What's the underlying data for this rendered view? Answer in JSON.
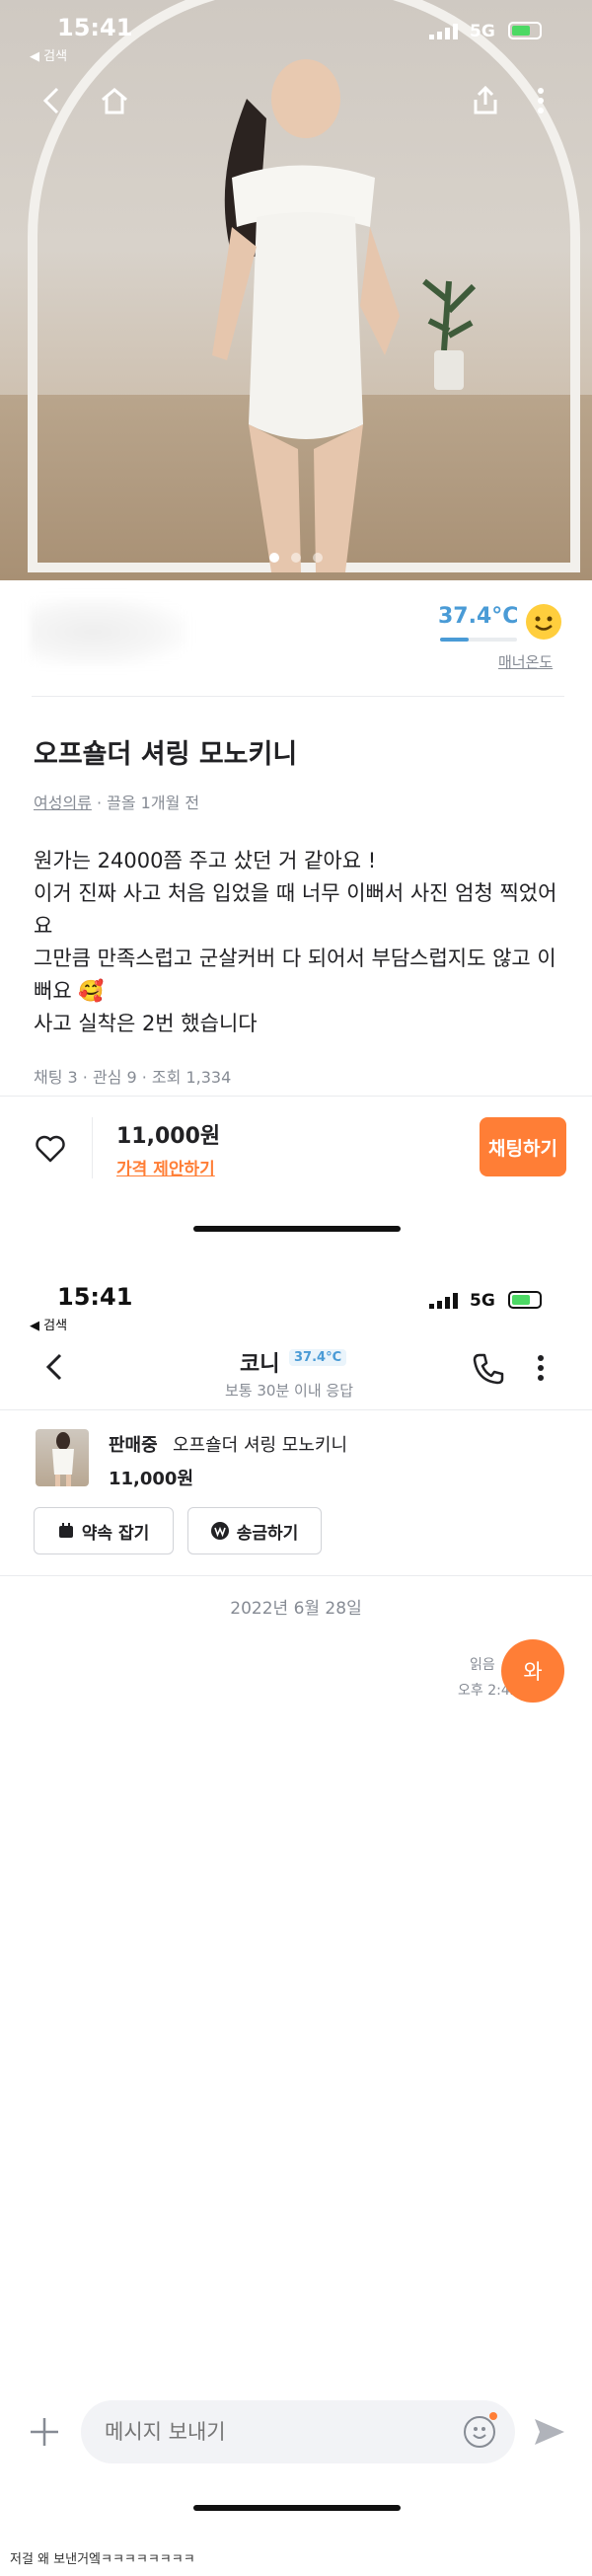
{
  "colors": {
    "accent": "#ff7e36",
    "temperature": "#4a9bd6",
    "text": "#212124",
    "muted": "#868b94",
    "divider": "#eaebee"
  },
  "listing_screen": {
    "status_bar": {
      "time": "15:41",
      "back_app": "◀ 검색",
      "network": "5G"
    },
    "icons": [
      "back-arrow-icon",
      "home-icon",
      "share-icon",
      "more-vertical-icon"
    ],
    "photo_pager": {
      "count": 3,
      "active_index": 0
    },
    "seller": {
      "temperature": "37.4°C",
      "temperature_level": 0.374,
      "manner_label": "매너온도"
    },
    "title": "오프숄더 셔링 모노키니",
    "category": "여성의류",
    "bumped": "· 끌올 1개월 전",
    "description": "원가는 24000쯤 주고 샀던 거 같아요 !\n이거 진짜 사고 처음 입었을 때 너무 이뻐서 사진 엄청 찍었어요\n그만큼 만족스럽고 군살커버 다 되어서 부담스럽지도 않고 이뻐요 🥰\n사고 실착은 2번 했습니다",
    "stats": "채팅 3 · 관심 9 · 조회 1,334",
    "price": "11,000원",
    "offer_link": "가격 제안하기",
    "chat_button": "채팅하기"
  },
  "chat_screen": {
    "status_bar": {
      "time": "15:41",
      "back_app": "◀ 검색",
      "network": "5G"
    },
    "partner": {
      "name": "코니",
      "temperature": "37.4°C",
      "response_time": "보통 30분 이내 응답"
    },
    "item": {
      "status": "판매중",
      "title": "오프숄더 셔링 모노키니",
      "price": "11,000원"
    },
    "actions": {
      "appointment": "약속 잡기",
      "transfer": "송금하기"
    },
    "date": "2022년 6월 28일",
    "message": {
      "text": "와",
      "read": "읽음",
      "time": "오후 2:42"
    },
    "input_placeholder": "메시지 보내기"
  },
  "caption": "저걸 왜 보낸거엨ㅋㅋㅋㅋㅋㅋㅋㅋ"
}
